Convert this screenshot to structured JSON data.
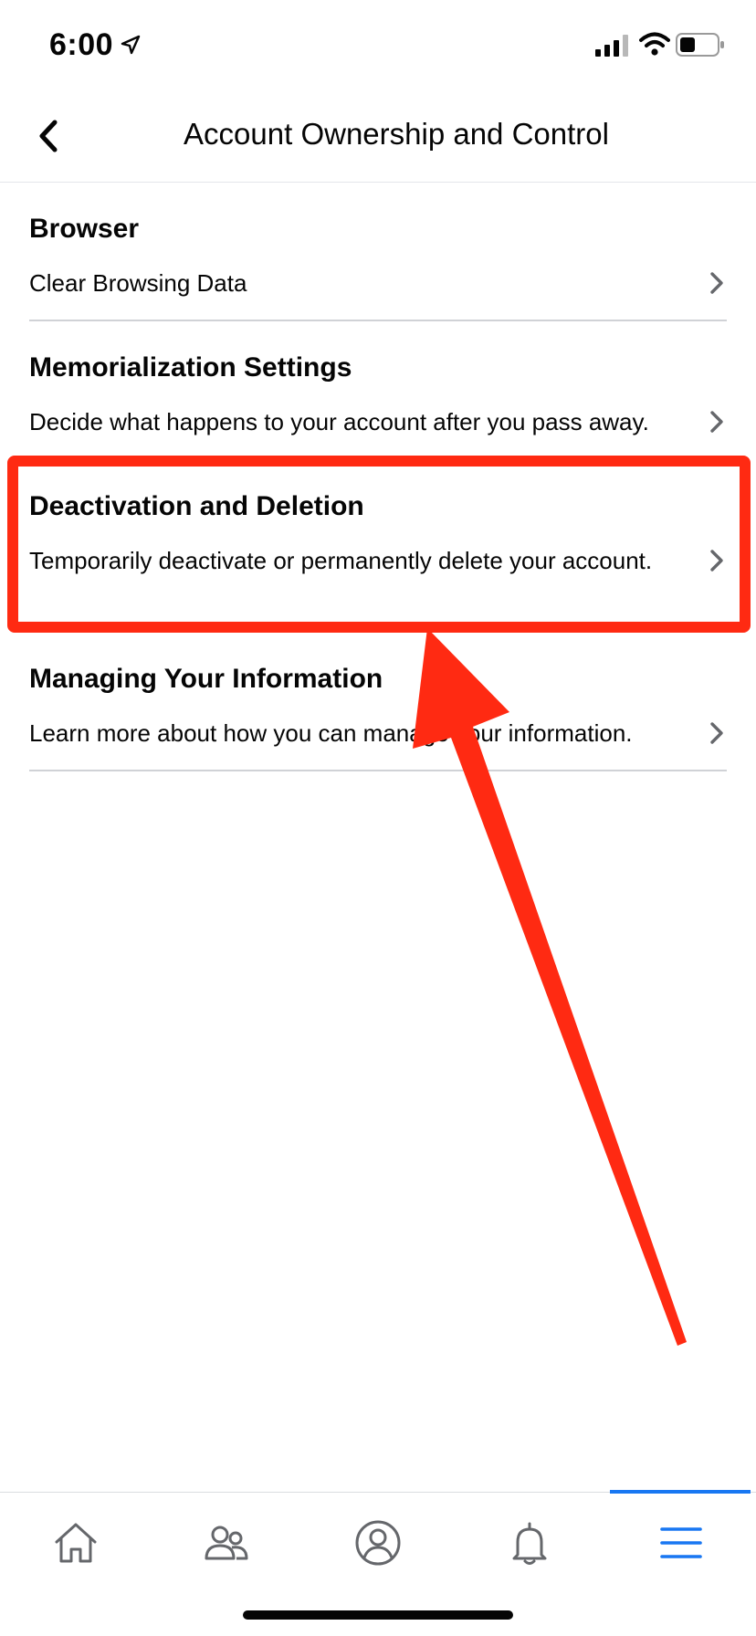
{
  "status_bar": {
    "time": "6:00"
  },
  "header": {
    "title": "Account Ownership and Control"
  },
  "sections": [
    {
      "title": "Browser",
      "description": "Clear Browsing Data"
    },
    {
      "title": "Memorialization Settings",
      "description": "Decide what happens to your account after you pass away."
    },
    {
      "title": "Deactivation and Deletion",
      "description": "Temporarily deactivate or permanently delete your account."
    },
    {
      "title": "Managing Your Information",
      "description": "Learn more about how you can manage your information."
    }
  ],
  "tab_bar": {
    "tabs": [
      {
        "icon": "home-icon"
      },
      {
        "icon": "friends-icon"
      },
      {
        "icon": "profile-icon"
      },
      {
        "icon": "bell-icon"
      },
      {
        "icon": "menu-icon",
        "active": true
      }
    ],
    "accent_color": "#1877f2"
  },
  "annotation": {
    "highlight_color": "#ff2a12"
  }
}
